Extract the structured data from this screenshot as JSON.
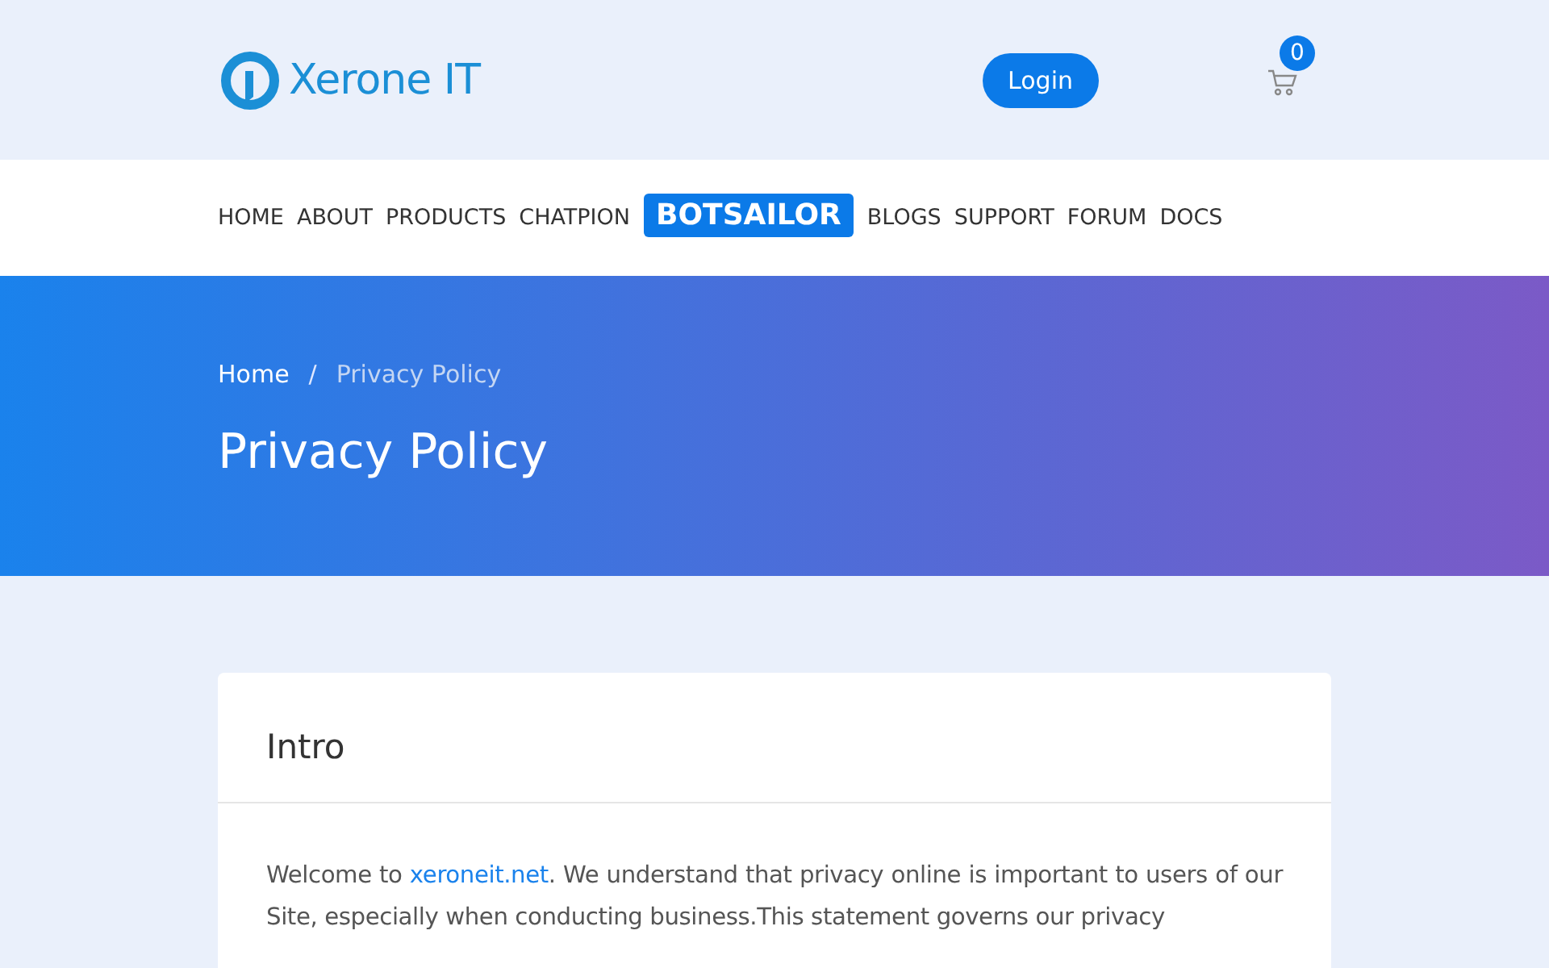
{
  "header": {
    "logo_text": "Xerone IT",
    "login_button": "Login",
    "cart_count": "0"
  },
  "nav": [
    {
      "label": "HOME",
      "kind": "plain"
    },
    {
      "label": "ABOUT",
      "kind": "plain"
    },
    {
      "label": "PRODUCTS",
      "kind": "plain"
    },
    {
      "label": "CHATPION",
      "kind": "plain"
    },
    {
      "label": "BOTSAILOR",
      "kind": "highlight"
    },
    {
      "label": "BLOGS",
      "kind": "plain"
    },
    {
      "label": "SUPPORT",
      "kind": "plain"
    },
    {
      "label": "FORUM",
      "kind": "plain"
    },
    {
      "label": "DOCS",
      "kind": "plain"
    }
  ],
  "hero": {
    "breadcrumb": [
      {
        "label": "Home",
        "selected": false
      },
      {
        "label": "Privacy Policy",
        "selected": true
      }
    ],
    "separator": "/",
    "title": "Privacy Policy"
  },
  "card": {
    "title": "Intro",
    "paragraph": {
      "before": "Welcome to ",
      "link": "xeroneit.net",
      "after": ". We understand that privacy online is important to users of our Site, especially when conducting business.This statement governs our privacy"
    }
  }
}
